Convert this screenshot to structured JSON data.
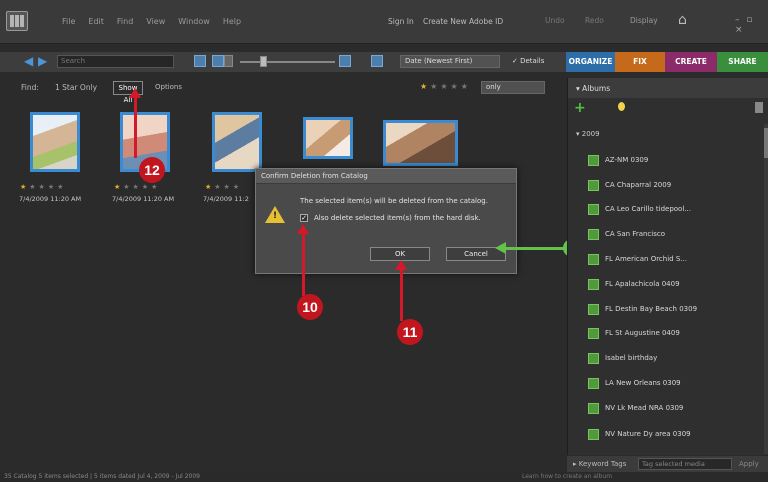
{
  "menubar": {
    "items": [
      "File",
      "Edit",
      "Find",
      "View",
      "Window",
      "Help"
    ],
    "sign_in": "Sign In",
    "create_id": "Create New Adobe ID",
    "undo": "Undo",
    "redo": "Redo",
    "display": "Display",
    "window_controls": "– ▫ ×"
  },
  "toolbar": {
    "search_placeholder": "Search",
    "sort": "Date (Newest First)",
    "details_label": "Details",
    "tabs": [
      "ORGANIZE",
      "FIX",
      "CREATE",
      "SHARE"
    ]
  },
  "findbar": {
    "find_label": "Find:",
    "rating_filter": "1 Star Only",
    "show_all": "Show All",
    "options": "Options",
    "condition": "only"
  },
  "thumbnails": [
    {
      "date": "7/4/2009 11:20 AM",
      "stars_gold": 1
    },
    {
      "date": "7/4/2009 11:20 AM",
      "stars_gold": 1
    },
    {
      "date": "7/4/2009 11:2",
      "stars_gold": 1
    }
  ],
  "dialog": {
    "title": "Confirm Deletion from Catalog",
    "message": "The selected item(s) will be deleted from the catalog.",
    "checkbox_label": "Also delete selected item(s) from the hard disk.",
    "checkbox_checked": true,
    "ok_label": "OK",
    "cancel_label": "Cancel"
  },
  "callouts": {
    "c10": "10",
    "c11": "11",
    "c12": "12"
  },
  "panel": {
    "header": "Albums",
    "year": "2009",
    "albums": [
      "AZ-NM 0309",
      "CA Chaparral 2009",
      "CA Leo Carillo tidepool...",
      "CA San Francisco",
      "FL American Orchid S...",
      "FL Apalachicola 0409",
      "FL Destin Bay Beach 0309",
      "FL St Augustine 0409",
      "Isabel birthday",
      "LA New Orleans 0309",
      "NV Lk Mead NRA 0309",
      "NV Nature Dy area 0309"
    ],
    "keyword_tags": "Keyword Tags",
    "tag_placeholder": "Tag selected media",
    "apply": "Apply"
  },
  "status": {
    "text": "35 Catalog   5 items selected  |  5 items dated Jul 4, 2009 - Jul 2009",
    "learn": "Learn how to create an album"
  },
  "colors": {
    "organize": "#2e6ea8",
    "fix": "#c56a1a",
    "create": "#8c2b6a",
    "share": "#3a8f3c",
    "callout_red": "#c2161f",
    "callout_green": "#63c24a"
  }
}
